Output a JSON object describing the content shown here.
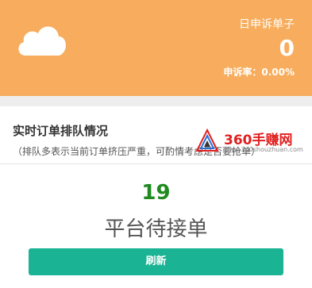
{
  "stat_card": {
    "icon": "cloud-icon",
    "title": "日申诉单子",
    "value": "0",
    "rate": "申诉率：0.00%",
    "background": "#f7ad5d"
  },
  "queue_panel": {
    "title": "实时订单排队情况",
    "description": "（排队多表示当前订单挤压严重，可酌情考虑是否要抢单）",
    "count": "19",
    "count_color": "#1f8a1f",
    "label": "平台待接单",
    "refresh_label": "刷新",
    "refresh_color": "#1ab394"
  },
  "watermark": {
    "text": "360手赚网",
    "subtext": "www.360shouzhuan.com"
  }
}
